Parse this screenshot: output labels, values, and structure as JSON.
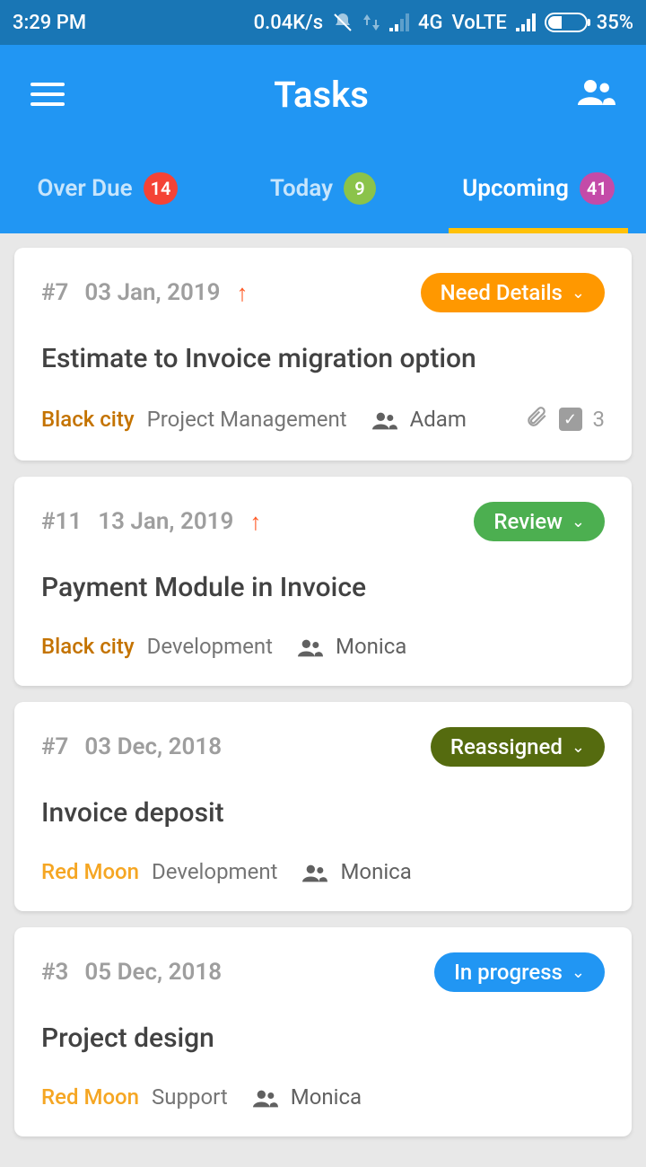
{
  "status": {
    "time": "3:29 PM",
    "speed": "0.04K/s",
    "net": "4G",
    "volte": "VoLTE",
    "battery": "35%"
  },
  "header": {
    "title": "Tasks"
  },
  "tabs": [
    {
      "label": "Over Due",
      "count": "14"
    },
    {
      "label": "Today",
      "count": "9"
    },
    {
      "label": "Upcoming",
      "count": "41"
    }
  ],
  "cards": [
    {
      "id": "#7",
      "date": "03 Jan, 2019",
      "priority": true,
      "status": "Need Details",
      "statusClass": "c-orange",
      "title": "Estimate to Invoice migration option",
      "client": "Black city",
      "clientClass": "client",
      "project": "Project Management",
      "assignee": "Adam",
      "hasAttach": true,
      "checkCount": "3"
    },
    {
      "id": "#11",
      "date": "13 Jan, 2019",
      "priority": true,
      "status": "Review",
      "statusClass": "c-green",
      "title": "Payment Module in Invoice",
      "client": "Black city",
      "clientClass": "client",
      "project": "Development",
      "assignee": "Monica",
      "hasAttach": false
    },
    {
      "id": "#7",
      "date": "03 Dec, 2018",
      "priority": false,
      "status": "Reassigned",
      "statusClass": "c-olive",
      "title": "Invoice deposit",
      "client": "Red Moon",
      "clientClass": "client red",
      "project": "Development",
      "assignee": "Monica",
      "hasAttach": false
    },
    {
      "id": "#3",
      "date": "05 Dec, 2018",
      "priority": false,
      "status": "In progress",
      "statusClass": "c-blue",
      "title": "Project design",
      "client": "Red Moon",
      "clientClass": "client red",
      "project": "Support",
      "assignee": "Monica",
      "hasAttach": false
    }
  ]
}
